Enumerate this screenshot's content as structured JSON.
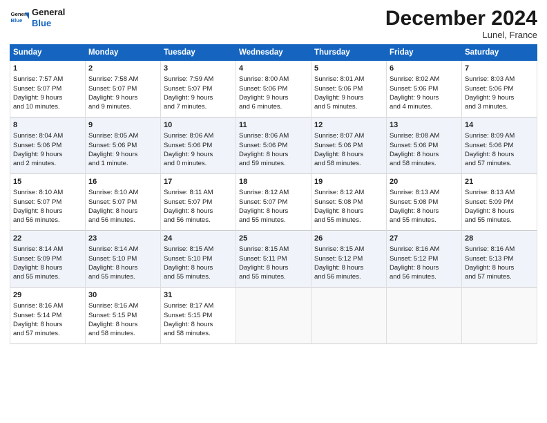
{
  "header": {
    "logo_line1": "General",
    "logo_line2": "Blue",
    "title": "December 2024",
    "location": "Lunel, France"
  },
  "days_of_week": [
    "Sunday",
    "Monday",
    "Tuesday",
    "Wednesday",
    "Thursday",
    "Friday",
    "Saturday"
  ],
  "weeks": [
    [
      {
        "day": "1",
        "lines": [
          "Sunrise: 7:57 AM",
          "Sunset: 5:07 PM",
          "Daylight: 9 hours",
          "and 10 minutes."
        ]
      },
      {
        "day": "2",
        "lines": [
          "Sunrise: 7:58 AM",
          "Sunset: 5:07 PM",
          "Daylight: 9 hours",
          "and 9 minutes."
        ]
      },
      {
        "day": "3",
        "lines": [
          "Sunrise: 7:59 AM",
          "Sunset: 5:07 PM",
          "Daylight: 9 hours",
          "and 7 minutes."
        ]
      },
      {
        "day": "4",
        "lines": [
          "Sunrise: 8:00 AM",
          "Sunset: 5:06 PM",
          "Daylight: 9 hours",
          "and 6 minutes."
        ]
      },
      {
        "day": "5",
        "lines": [
          "Sunrise: 8:01 AM",
          "Sunset: 5:06 PM",
          "Daylight: 9 hours",
          "and 5 minutes."
        ]
      },
      {
        "day": "6",
        "lines": [
          "Sunrise: 8:02 AM",
          "Sunset: 5:06 PM",
          "Daylight: 9 hours",
          "and 4 minutes."
        ]
      },
      {
        "day": "7",
        "lines": [
          "Sunrise: 8:03 AM",
          "Sunset: 5:06 PM",
          "Daylight: 9 hours",
          "and 3 minutes."
        ]
      }
    ],
    [
      {
        "day": "8",
        "lines": [
          "Sunrise: 8:04 AM",
          "Sunset: 5:06 PM",
          "Daylight: 9 hours",
          "and 2 minutes."
        ]
      },
      {
        "day": "9",
        "lines": [
          "Sunrise: 8:05 AM",
          "Sunset: 5:06 PM",
          "Daylight: 9 hours",
          "and 1 minute."
        ]
      },
      {
        "day": "10",
        "lines": [
          "Sunrise: 8:06 AM",
          "Sunset: 5:06 PM",
          "Daylight: 9 hours",
          "and 0 minutes."
        ]
      },
      {
        "day": "11",
        "lines": [
          "Sunrise: 8:06 AM",
          "Sunset: 5:06 PM",
          "Daylight: 8 hours",
          "and 59 minutes."
        ]
      },
      {
        "day": "12",
        "lines": [
          "Sunrise: 8:07 AM",
          "Sunset: 5:06 PM",
          "Daylight: 8 hours",
          "and 58 minutes."
        ]
      },
      {
        "day": "13",
        "lines": [
          "Sunrise: 8:08 AM",
          "Sunset: 5:06 PM",
          "Daylight: 8 hours",
          "and 58 minutes."
        ]
      },
      {
        "day": "14",
        "lines": [
          "Sunrise: 8:09 AM",
          "Sunset: 5:06 PM",
          "Daylight: 8 hours",
          "and 57 minutes."
        ]
      }
    ],
    [
      {
        "day": "15",
        "lines": [
          "Sunrise: 8:10 AM",
          "Sunset: 5:07 PM",
          "Daylight: 8 hours",
          "and 56 minutes."
        ]
      },
      {
        "day": "16",
        "lines": [
          "Sunrise: 8:10 AM",
          "Sunset: 5:07 PM",
          "Daylight: 8 hours",
          "and 56 minutes."
        ]
      },
      {
        "day": "17",
        "lines": [
          "Sunrise: 8:11 AM",
          "Sunset: 5:07 PM",
          "Daylight: 8 hours",
          "and 56 minutes."
        ]
      },
      {
        "day": "18",
        "lines": [
          "Sunrise: 8:12 AM",
          "Sunset: 5:07 PM",
          "Daylight: 8 hours",
          "and 55 minutes."
        ]
      },
      {
        "day": "19",
        "lines": [
          "Sunrise: 8:12 AM",
          "Sunset: 5:08 PM",
          "Daylight: 8 hours",
          "and 55 minutes."
        ]
      },
      {
        "day": "20",
        "lines": [
          "Sunrise: 8:13 AM",
          "Sunset: 5:08 PM",
          "Daylight: 8 hours",
          "and 55 minutes."
        ]
      },
      {
        "day": "21",
        "lines": [
          "Sunrise: 8:13 AM",
          "Sunset: 5:09 PM",
          "Daylight: 8 hours",
          "and 55 minutes."
        ]
      }
    ],
    [
      {
        "day": "22",
        "lines": [
          "Sunrise: 8:14 AM",
          "Sunset: 5:09 PM",
          "Daylight: 8 hours",
          "and 55 minutes."
        ]
      },
      {
        "day": "23",
        "lines": [
          "Sunrise: 8:14 AM",
          "Sunset: 5:10 PM",
          "Daylight: 8 hours",
          "and 55 minutes."
        ]
      },
      {
        "day": "24",
        "lines": [
          "Sunrise: 8:15 AM",
          "Sunset: 5:10 PM",
          "Daylight: 8 hours",
          "and 55 minutes."
        ]
      },
      {
        "day": "25",
        "lines": [
          "Sunrise: 8:15 AM",
          "Sunset: 5:11 PM",
          "Daylight: 8 hours",
          "and 55 minutes."
        ]
      },
      {
        "day": "26",
        "lines": [
          "Sunrise: 8:15 AM",
          "Sunset: 5:12 PM",
          "Daylight: 8 hours",
          "and 56 minutes."
        ]
      },
      {
        "day": "27",
        "lines": [
          "Sunrise: 8:16 AM",
          "Sunset: 5:12 PM",
          "Daylight: 8 hours",
          "and 56 minutes."
        ]
      },
      {
        "day": "28",
        "lines": [
          "Sunrise: 8:16 AM",
          "Sunset: 5:13 PM",
          "Daylight: 8 hours",
          "and 57 minutes."
        ]
      }
    ],
    [
      {
        "day": "29",
        "lines": [
          "Sunrise: 8:16 AM",
          "Sunset: 5:14 PM",
          "Daylight: 8 hours",
          "and 57 minutes."
        ]
      },
      {
        "day": "30",
        "lines": [
          "Sunrise: 8:16 AM",
          "Sunset: 5:15 PM",
          "Daylight: 8 hours",
          "and 58 minutes."
        ]
      },
      {
        "day": "31",
        "lines": [
          "Sunrise: 8:17 AM",
          "Sunset: 5:15 PM",
          "Daylight: 8 hours",
          "and 58 minutes."
        ]
      },
      null,
      null,
      null,
      null
    ]
  ]
}
